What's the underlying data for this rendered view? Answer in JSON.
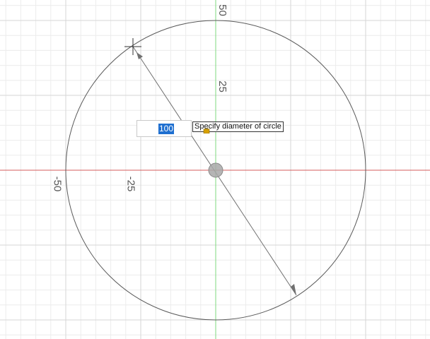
{
  "sketch": {
    "x_ticks": [
      "-50",
      "-25"
    ],
    "y_ticks": [
      "50",
      "25"
    ],
    "circle_diameter": 100,
    "colors": {
      "background": "#ffffff",
      "grid_minor": "#ececec",
      "grid_major": "#d6d6d6",
      "x_axis": "#d45c5c",
      "y_axis": "#7fd87f",
      "geometry": "#5a5a5a"
    }
  },
  "dimension_input": {
    "value": "100",
    "tooltip": "Specify diameter of circle",
    "lock_icon": "lock-icon"
  }
}
